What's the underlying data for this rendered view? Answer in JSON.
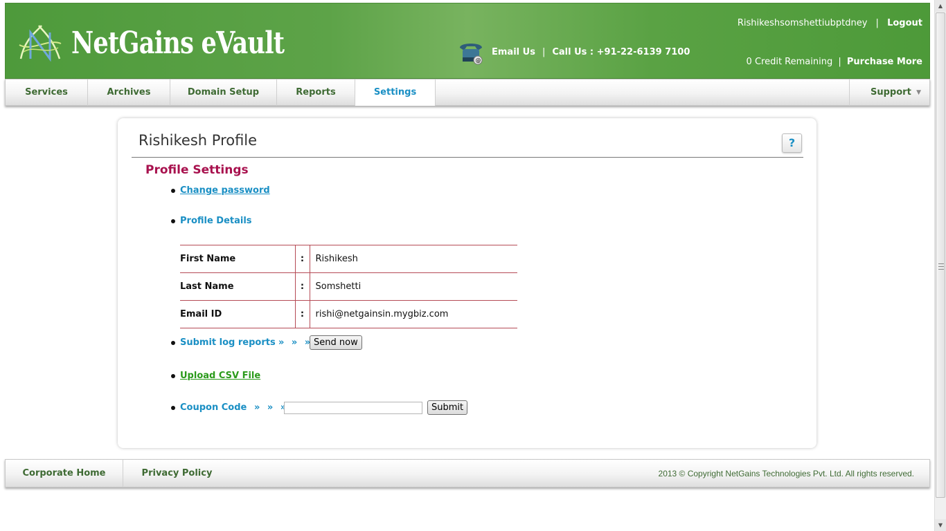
{
  "header": {
    "brand": "NetGains  eVault",
    "email_us": "Email Us",
    "contact_sep": "|",
    "call_us": "Call Us : +91-22-6139 7100",
    "username": "Rishikeshsomshettiubptdney",
    "user_sep": "|",
    "logout": "Logout",
    "credit_text": "0 Credit Remaining",
    "credit_sep": "|",
    "purchase_more": "Purchase More"
  },
  "nav": {
    "items": [
      {
        "label": "Services"
      },
      {
        "label": "Archives"
      },
      {
        "label": "Domain Setup"
      },
      {
        "label": "Reports"
      },
      {
        "label": "Settings"
      }
    ],
    "support": "Support",
    "support_caret": "▼"
  },
  "main": {
    "page_title": "Rishikesh Profile",
    "help": "?",
    "section_title": "Profile Settings",
    "change_password": "Change password",
    "profile_details": "Profile Details",
    "details": [
      {
        "label": "First Name",
        "colon": ":",
        "value": "Rishikesh"
      },
      {
        "label": "Last Name",
        "colon": ":",
        "value": "Somshetti"
      },
      {
        "label": "Email ID",
        "colon": ":",
        "value": "rishi@netgainsin.mygbiz.com"
      }
    ],
    "submit_log_reports": "Submit log reports",
    "arrows": "» » »",
    "send_now": "Send now",
    "upload_csv": "Upload CSV File",
    "coupon_code": "Coupon Code",
    "coupon_value": "",
    "submit": "Submit"
  },
  "footer": {
    "corporate_home": "Corporate Home",
    "privacy_policy": "Privacy Policy",
    "copyright": "2013 © Copyright NetGains Technologies Pvt. Ltd. All rights reserved."
  },
  "colors": {
    "header_green": "#5da348",
    "nav_text": "#3e6a33",
    "active_tab": "#1a8fc4",
    "section_title": "#a8114e",
    "table_rule": "#b54a55",
    "csv_link": "#2a9a1a"
  }
}
